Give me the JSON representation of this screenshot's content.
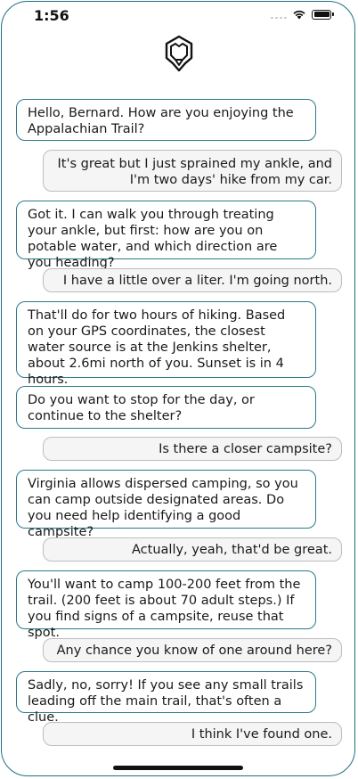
{
  "status_bar": {
    "time": "1:56"
  },
  "messages": [
    {
      "role": "assistant",
      "text": "Hello, Bernard. How are you enjoying the Appalachian Trail?"
    },
    {
      "role": "user",
      "text": "It's great but I just sprained my ankle, and I'm two days' hike from my car."
    },
    {
      "role": "assistant",
      "text": "Got it. I can walk you through treating your ankle, but first: how are you on potable water, and which direction are you heading?"
    },
    {
      "role": "user",
      "text": "I have a little over a liter. I'm going north."
    },
    {
      "role": "assistant",
      "text": "That'll do for two hours of hiking. Based on your GPS coordinates, the closest water source is at the Jenkins shelter, about 2.6mi north of you. Sunset is in 4 hours."
    },
    {
      "role": "assistant",
      "text": "Do you want to stop for the day, or continue to the shelter?"
    },
    {
      "role": "user",
      "text": "Is there a closer campsite?"
    },
    {
      "role": "assistant",
      "text": "Virginia allows dispersed camping, so you can camp outside designated areas. Do you need help identifying a good campsite?"
    },
    {
      "role": "user",
      "text": "Actually, yeah, that'd be great."
    },
    {
      "role": "assistant",
      "text": "You'll want to camp 100-200 feet from the trail. (200 feet is about 70 adult steps.) If you find signs of a campsite, reuse that spot."
    },
    {
      "role": "user",
      "text": "Any chance you know of one around here?"
    },
    {
      "role": "assistant",
      "text": "Sadly, no, sorry! If you see any small trails leading off the main trail, that's often a clue."
    },
    {
      "role": "user",
      "text": "I think I've found one."
    }
  ]
}
